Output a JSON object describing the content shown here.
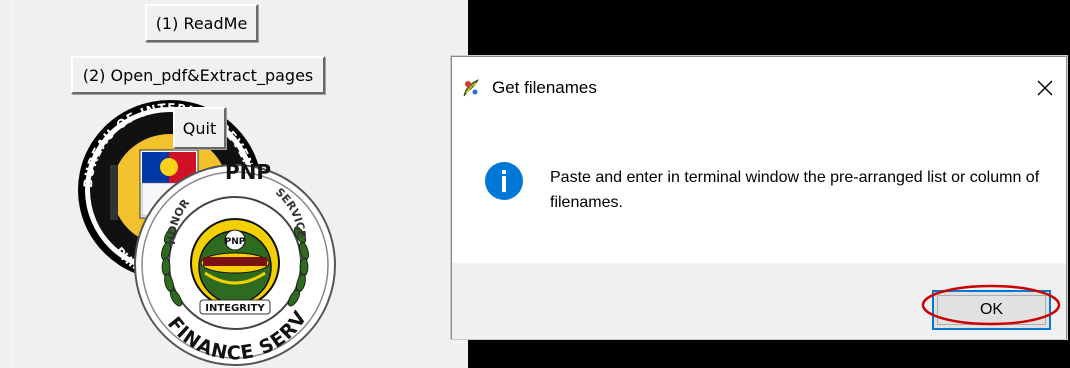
{
  "app": {
    "buttons": {
      "readme": "(1) ReadMe",
      "open_pdf": "(2) Open_pdf&Extract_pages",
      "quit": "Quit"
    },
    "logos": {
      "bir_text_top": "BUREAU OF INTERNAL REVENUE",
      "bir_text_bottom": "PHILIPPINES",
      "pnp_top": "PNP",
      "pnp_left": "HONOR",
      "pnp_right": "SERVICE",
      "pnp_middle": "INTEGRITY",
      "pnp_bottom": "FINANCE SERVICE"
    }
  },
  "dialog": {
    "title": "Get filenames",
    "message": "Paste and enter in terminal window the pre-arranged list or column of filenames.",
    "ok_label": "OK",
    "close_glyph": "✕"
  },
  "colors": {
    "window_bg": "#f0f0f0",
    "console_bg": "#000000",
    "info_blue": "#0078d7",
    "annotation_red": "#cc0000",
    "bir_gold": "#f2c12e",
    "pnp_green": "#2e6b1f",
    "pnp_yellow": "#f5d000"
  }
}
